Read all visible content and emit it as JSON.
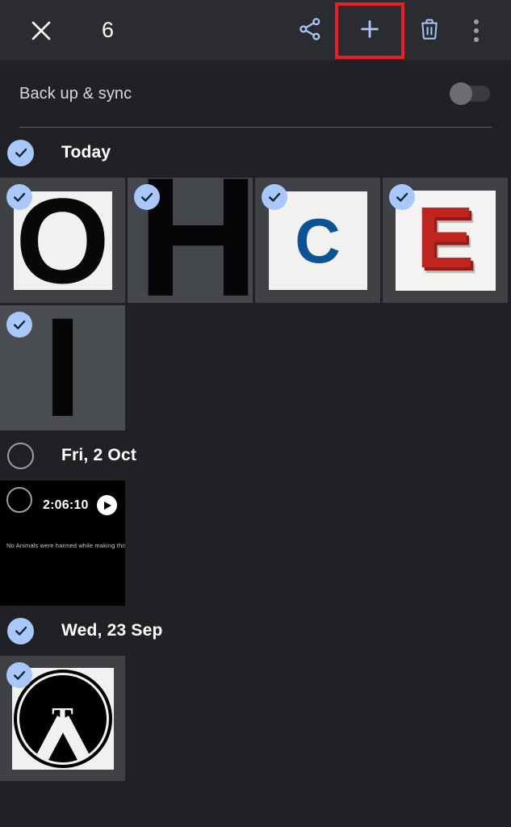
{
  "appbar": {
    "close_icon": "close-icon",
    "selected_count": "6",
    "share_icon": "share-icon",
    "add_icon": "plus-icon",
    "delete_icon": "trash-icon",
    "overflow_icon": "more-vertical-icon",
    "highlight_color": "#ee1c25",
    "icon_color": "#a8c7fa",
    "background": "#2b2c2f"
  },
  "backup": {
    "label": "Back up & sync",
    "toggle_state": "off",
    "toggle_name": "backup-sync-toggle"
  },
  "theme": {
    "background": "#202124",
    "tile_background": "#3f4145",
    "accent": "#a8c7fa",
    "text_primary": "#ffffff",
    "text_secondary": "#9aa0a6"
  },
  "sections": [
    {
      "title": "Today",
      "selected": true,
      "items": [
        {
          "name": "photo-letter-o",
          "type": "photo",
          "selected": true,
          "glyph": "O",
          "glyph_color": "#080808",
          "card_bg": "#f1f2f0",
          "tile_bg": "#3f4145",
          "style": "card"
        },
        {
          "name": "photo-letter-h",
          "type": "photo",
          "selected": true,
          "glyph": "H",
          "glyph_color": "#050505",
          "card_bg": "#43464a",
          "tile_bg": "#43464a",
          "style": "full-bleed"
        },
        {
          "name": "photo-letter-c",
          "type": "photo",
          "selected": true,
          "glyph": "C",
          "glyph_color": "#0b5394",
          "card_bg": "#f1f2f0",
          "tile_bg": "#3f4145",
          "style": "card"
        },
        {
          "name": "photo-letter-e",
          "type": "photo",
          "selected": true,
          "glyph": "E",
          "glyph_color": "#c0241f",
          "card_bg": "#f3f3f1",
          "tile_bg": "#3f4145",
          "style": "card-3d"
        },
        {
          "name": "photo-letter-i",
          "type": "photo",
          "selected": true,
          "glyph": "I",
          "glyph_color": "#050505",
          "card_bg": "#494c50",
          "tile_bg": "#494c50",
          "style": "full-bleed"
        }
      ]
    },
    {
      "title": "Fri, 2 Oct",
      "selected": false,
      "items": [
        {
          "name": "video-thumbnail",
          "type": "video",
          "selected": false,
          "duration": "2:06:10",
          "caption": "No Animals were harmed while making this film.",
          "play_icon": "play-icon",
          "tile_bg": "#000000"
        }
      ]
    },
    {
      "title": "Wed, 23 Sep",
      "selected": true,
      "items": [
        {
          "name": "photo-grunge-t-logo",
          "type": "photo",
          "selected": true,
          "glyph": "T",
          "glyph_color": "#f1f2f0",
          "card_bg": "#f1f2f0",
          "tile_bg": "#3f4145",
          "style": "grunge-logo"
        }
      ]
    }
  ]
}
